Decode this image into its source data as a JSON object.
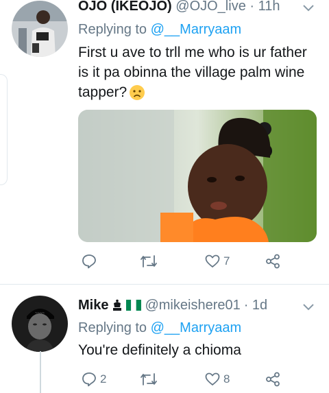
{
  "tweets": [
    {
      "display_name": "OJO (IKEOJO)",
      "handle": "@OJO_live",
      "time": "· 11h",
      "replying_prefix": "Replying to",
      "replying_to": "@__Marryaam",
      "text_lines": [
        "First u ave to trll me who is ur father",
        "is it pa obinna the village palm wine",
        "tapper?"
      ],
      "emoji": "worried-face",
      "has_photo": true,
      "actions": {
        "reply_count": "",
        "retweet_count": "",
        "like_count": "7"
      }
    },
    {
      "display_name": "Mike",
      "name_badges": [
        "king-icon",
        "nigeria-flag"
      ],
      "handle": "@mikeishere01",
      "time": "· 1d",
      "replying_prefix": "Replying to",
      "replying_to": "@__Marryaam",
      "text_lines": [
        "You're definitely a chioma"
      ],
      "has_photo": false,
      "actions": {
        "reply_count": "2",
        "retweet_count": "",
        "like_count": "8"
      }
    }
  ],
  "colors": {
    "text": "#14171a",
    "muted": "#657786",
    "link": "#1da1f2",
    "divider": "#e1e8ed",
    "flag_green": "#008751"
  }
}
